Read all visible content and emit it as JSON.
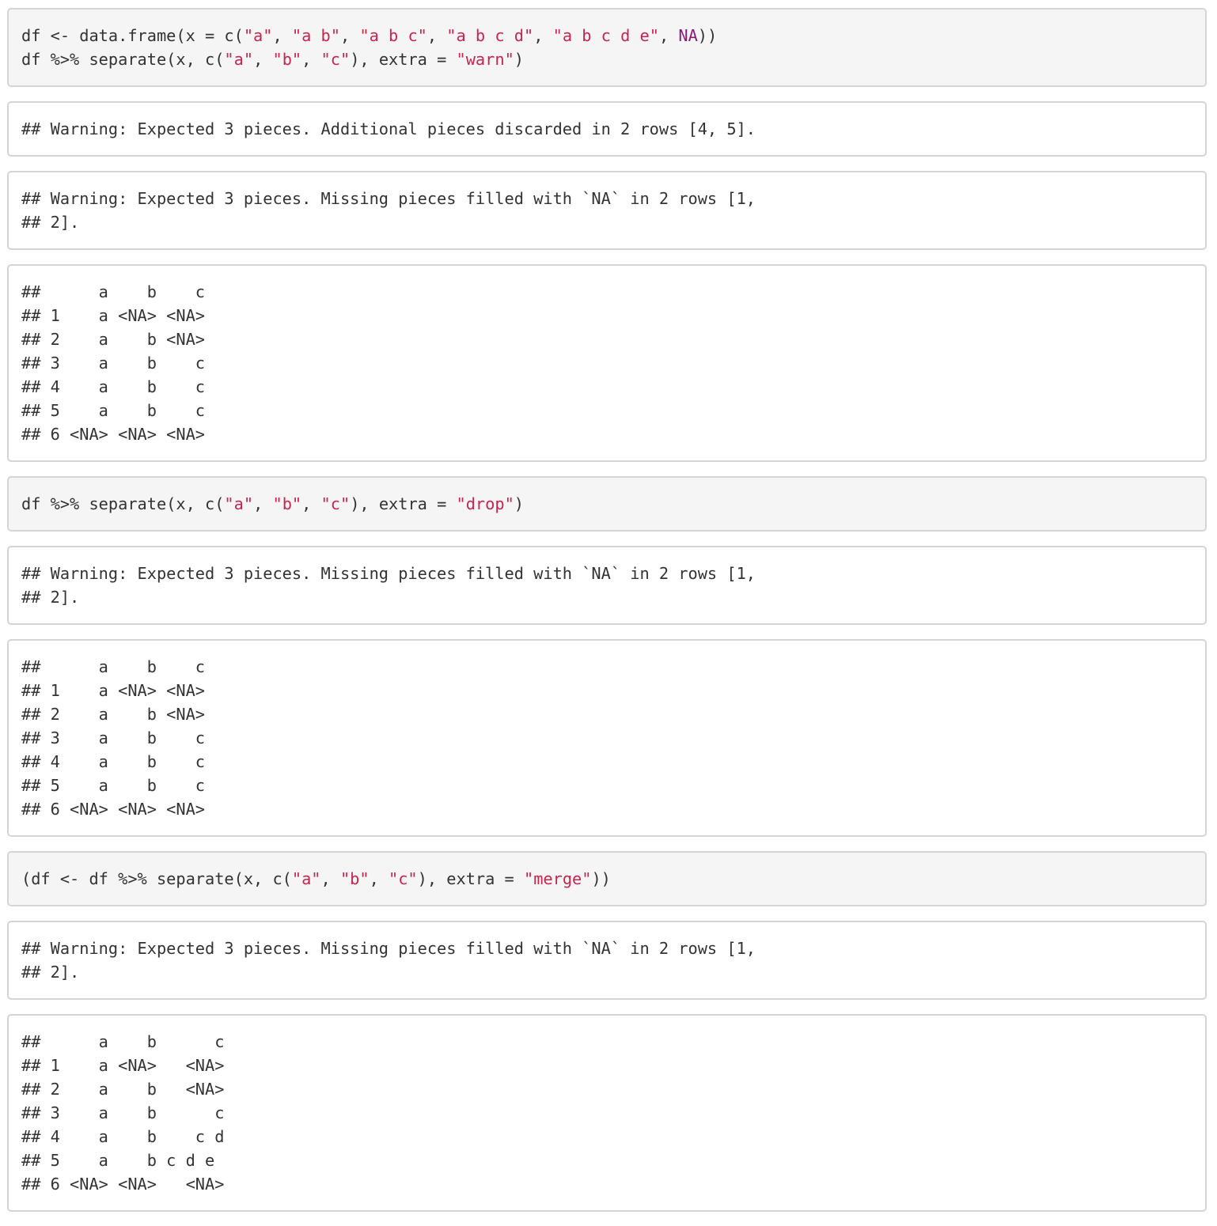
{
  "blocks": [
    {
      "kind": "source",
      "lines": [
        [
          {
            "t": "df <- data.frame(x = c(",
            "c": "plain"
          },
          {
            "t": "\"a\"",
            "c": "str"
          },
          {
            "t": ", ",
            "c": "plain"
          },
          {
            "t": "\"a b\"",
            "c": "str"
          },
          {
            "t": ", ",
            "c": "plain"
          },
          {
            "t": "\"a b c\"",
            "c": "str"
          },
          {
            "t": ", ",
            "c": "plain"
          },
          {
            "t": "\"a b c d\"",
            "c": "str"
          },
          {
            "t": ", ",
            "c": "plain"
          },
          {
            "t": "\"a b c d e\"",
            "c": "str"
          },
          {
            "t": ", ",
            "c": "plain"
          },
          {
            "t": "NA",
            "c": "na"
          },
          {
            "t": "))",
            "c": "plain"
          }
        ],
        [
          {
            "t": "df %>% separate(x, c(",
            "c": "plain"
          },
          {
            "t": "\"a\"",
            "c": "str"
          },
          {
            "t": ", ",
            "c": "plain"
          },
          {
            "t": "\"b\"",
            "c": "str"
          },
          {
            "t": ", ",
            "c": "plain"
          },
          {
            "t": "\"c\"",
            "c": "str"
          },
          {
            "t": "), extra = ",
            "c": "plain"
          },
          {
            "t": "\"warn\"",
            "c": "str"
          },
          {
            "t": ")",
            "c": "plain"
          }
        ]
      ]
    },
    {
      "kind": "output",
      "lines": [
        [
          {
            "t": "## Warning: Expected 3 pieces. Additional pieces discarded in 2 rows [4, 5].",
            "c": "plain"
          }
        ]
      ]
    },
    {
      "kind": "output",
      "lines": [
        [
          {
            "t": "## Warning: Expected 3 pieces. Missing pieces filled with `NA` in 2 rows [1,",
            "c": "plain"
          }
        ],
        [
          {
            "t": "## 2].",
            "c": "plain"
          }
        ]
      ]
    },
    {
      "kind": "output",
      "lines": [
        [
          {
            "t": "##      a    b    c",
            "c": "plain"
          }
        ],
        [
          {
            "t": "## 1    a <NA> <NA>",
            "c": "plain"
          }
        ],
        [
          {
            "t": "## 2    a    b <NA>",
            "c": "plain"
          }
        ],
        [
          {
            "t": "## 3    a    b    c",
            "c": "plain"
          }
        ],
        [
          {
            "t": "## 4    a    b    c",
            "c": "plain"
          }
        ],
        [
          {
            "t": "## 5    a    b    c",
            "c": "plain"
          }
        ],
        [
          {
            "t": "## 6 <NA> <NA> <NA>",
            "c": "plain"
          }
        ]
      ]
    },
    {
      "kind": "source",
      "lines": [
        [
          {
            "t": "df %>% separate(x, c(",
            "c": "plain"
          },
          {
            "t": "\"a\"",
            "c": "str"
          },
          {
            "t": ", ",
            "c": "plain"
          },
          {
            "t": "\"b\"",
            "c": "str"
          },
          {
            "t": ", ",
            "c": "plain"
          },
          {
            "t": "\"c\"",
            "c": "str"
          },
          {
            "t": "), extra = ",
            "c": "plain"
          },
          {
            "t": "\"drop\"",
            "c": "str"
          },
          {
            "t": ")",
            "c": "plain"
          }
        ]
      ]
    },
    {
      "kind": "output",
      "lines": [
        [
          {
            "t": "## Warning: Expected 3 pieces. Missing pieces filled with `NA` in 2 rows [1,",
            "c": "plain"
          }
        ],
        [
          {
            "t": "## 2].",
            "c": "plain"
          }
        ]
      ]
    },
    {
      "kind": "output",
      "lines": [
        [
          {
            "t": "##      a    b    c",
            "c": "plain"
          }
        ],
        [
          {
            "t": "## 1    a <NA> <NA>",
            "c": "plain"
          }
        ],
        [
          {
            "t": "## 2    a    b <NA>",
            "c": "plain"
          }
        ],
        [
          {
            "t": "## 3    a    b    c",
            "c": "plain"
          }
        ],
        [
          {
            "t": "## 4    a    b    c",
            "c": "plain"
          }
        ],
        [
          {
            "t": "## 5    a    b    c",
            "c": "plain"
          }
        ],
        [
          {
            "t": "## 6 <NA> <NA> <NA>",
            "c": "plain"
          }
        ]
      ]
    },
    {
      "kind": "source",
      "lines": [
        [
          {
            "t": "(df <- df %>% separate(x, c(",
            "c": "plain"
          },
          {
            "t": "\"a\"",
            "c": "str"
          },
          {
            "t": ", ",
            "c": "plain"
          },
          {
            "t": "\"b\"",
            "c": "str"
          },
          {
            "t": ", ",
            "c": "plain"
          },
          {
            "t": "\"c\"",
            "c": "str"
          },
          {
            "t": "), extra = ",
            "c": "plain"
          },
          {
            "t": "\"merge\"",
            "c": "str"
          },
          {
            "t": "))",
            "c": "plain"
          }
        ]
      ]
    },
    {
      "kind": "output",
      "lines": [
        [
          {
            "t": "## Warning: Expected 3 pieces. Missing pieces filled with `NA` in 2 rows [1,",
            "c": "plain"
          }
        ],
        [
          {
            "t": "## 2].",
            "c": "plain"
          }
        ]
      ]
    },
    {
      "kind": "output",
      "lines": [
        [
          {
            "t": "##      a    b      c",
            "c": "plain"
          }
        ],
        [
          {
            "t": "## 1    a <NA>   <NA>",
            "c": "plain"
          }
        ],
        [
          {
            "t": "## 2    a    b   <NA>",
            "c": "plain"
          }
        ],
        [
          {
            "t": "## 3    a    b      c",
            "c": "plain"
          }
        ],
        [
          {
            "t": "## 4    a    b    c d",
            "c": "plain"
          }
        ],
        [
          {
            "t": "## 5    a    b c d e",
            "c": "plain"
          }
        ],
        [
          {
            "t": "## 6 <NA> <NA>   <NA>",
            "c": "plain"
          }
        ]
      ]
    }
  ],
  "colors": {
    "string": "#c7254e",
    "na_constant": "#8e1a78",
    "text": "#333333",
    "source_bg": "#f5f5f5",
    "output_bg": "#ffffff",
    "border": "#d5d5d5"
  }
}
